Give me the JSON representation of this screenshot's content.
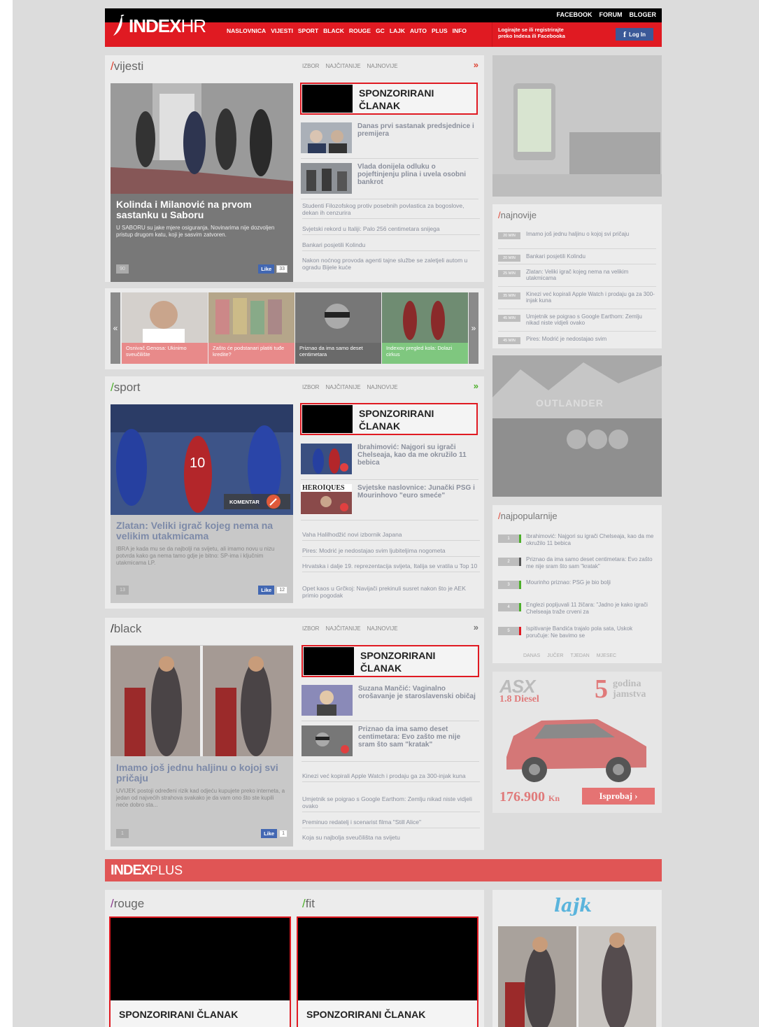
{
  "header": {
    "logo_text": "INDEX",
    "logo_suffix": "HR",
    "top_links": [
      "FACEBOOK",
      "FORUM",
      "BLOGER"
    ],
    "nav": [
      "NASLOVNICA",
      "VIJESTI",
      "SPORT",
      "BLACK",
      "ROUGE",
      "GC",
      "LAJK",
      "AUTO",
      "PLUS",
      "INFO"
    ],
    "login_text_1": "Logirajte se ili registrirajte",
    "login_text_2": "preko Indexa ili Facebooka",
    "login_button": "Log In",
    "fb_glyph": "f"
  },
  "tabs": [
    "IZBOR",
    "NAJČITANIJE",
    "NAJNOVIJE"
  ],
  "sponsored_label_1": "SPONZORIRANI",
  "sponsored_label_2": "ČLANAK",
  "sponsored_full": "SPONZORIRANI ČLANAK",
  "more_glyph": "»",
  "vijesti": {
    "slash": "/",
    "name": "vijesti",
    "main_title": "Kolinda i Milanović na prvom sastanku u Saboru",
    "main_desc": "U SABORU su jake mjere osiguranja. Novinarima nije dozvoljen pristup drugom katu, koji je sasvim zatvoren.",
    "comments": "90",
    "like_label": "Like",
    "likes": "33",
    "articles": [
      "Danas prvi sastanak predsjednice i premijera",
      "Vlada donijela odluku o pojeftinjenju plina i uvela osobni bankrot"
    ],
    "links": [
      "Studenti Filozofskog protiv posebnih povlastica za bogoslove, dekan ih cenzurira",
      "Svjetski rekord u Italiji: Palo 256 centimetara snijega",
      "Bankari posjetili Kolindu",
      "Nakon noćnog provoda agenti tajne službe se zaletjeli autom u ogradu Bijele kuće"
    ]
  },
  "carousel": {
    "prev": "«",
    "next": "»",
    "items": [
      "Osnivač Genosa: Ukinimo sveučilište",
      "Zašto će podstanari platiti tuđe kredite?",
      "Priznao da ima samo deset centimetara",
      "Indexov pregled kola: Dolazi cirkus"
    ]
  },
  "sport": {
    "slash": "/",
    "name": "sport",
    "comment_badge": "KOMENTAR",
    "main_title": "Zlatan: Veliki igrač kojeg nema na velikim utakmicama",
    "main_desc": "IBRA je kada mu se da najbolji na svijetu, ali imamo novu u nizu potvrda kako ga nema tamo gdje je bitno: SP-ima i ključnim utakmicama LP.",
    "comments": "13",
    "like_label": "Like",
    "likes": "12",
    "thumb_label": "HÉROÏQUES",
    "articles": [
      "Ibrahimović: Najgori su igrači Chelseaja, kao da me okružilo 11 bebica",
      "Svjetske naslovnice: Junački PSG i Mourinhovo \"euro smeće\""
    ],
    "links": [
      "Vaha Halilhodžić novi izbornik Japana",
      "Pires: Modrić je nedostajao svim ljubiteljima nogometa",
      "Hrvatska i dalje 19. reprezentacija svijeta, Italija se vratila u Top 10",
      "Opet kaos u Grčkoj: Navijači prekinuli susret nakon što je AEK primio pogodak"
    ]
  },
  "black": {
    "slash": "/",
    "name": "black",
    "main_title": "Imamo još jednu haljinu o kojoj svi pričaju",
    "main_desc": "UVIJEK postoji određeni rizik kad odjeću kupujete preko interneta, a jedan od najvećih strahova svakako je da vam ono što ste kupili neće dobro sta...",
    "comments": "1",
    "like_label": "Like",
    "likes": "1",
    "articles": [
      "Suzana Mančić: Vaginalno orošavanje je staroslavenski običaj",
      "Priznao da ima samo deset centimetara: Evo zašto me nije sram što sam \"kratak\""
    ],
    "links": [
      "Kinezi već kopirali Apple Watch i prodaju ga za 300-injak kuna",
      "Umjetnik se poigrao s Google Earthom: Zemlju nikad niste vidjeli ovako",
      "Preminuo redatelj i scenarist filma \"Still Alice\"",
      "Koja su najbolja sveučilišta na svijetu"
    ]
  },
  "najnovije": {
    "slash": "/",
    "name": "najnovije",
    "items": [
      {
        "time": "20 MIN",
        "text": "Imamo još jednu haljinu o kojoj svi pričaju"
      },
      {
        "time": "20 MIN",
        "text": "Bankari posjetili Kolindu"
      },
      {
        "time": "25 MIN",
        "text": "Zlatan: Veliki igrač kojeg nema na velikim utakmicama"
      },
      {
        "time": "35 MIN",
        "text": "Kinezi već kopirali Apple Watch i prodaju ga za 300-injak kuna"
      },
      {
        "time": "45 MIN",
        "text": "Umjetnik se poigrao s Google Earthom: Zemlju nikad niste vidjeli ovako"
      },
      {
        "time": "45 MIN",
        "text": "Pires: Modrić je nedostajao svim"
      }
    ]
  },
  "najpopularnije": {
    "slash": "/",
    "name": "najpopularnije",
    "items": [
      {
        "num": "1",
        "color": "#4caf2a",
        "text": "Ibrahimović: Najgori su igrači Chelseaja, kao da me okružilo 11 bebica"
      },
      {
        "num": "2",
        "color": "#555555",
        "text": "Priznao da ima samo deset centimetara: Evo zašto me nije sram što sam \"kratak\""
      },
      {
        "num": "3",
        "color": "#4caf2a",
        "text": "Mourinho priznao: PSG je bio bolji"
      },
      {
        "num": "4",
        "color": "#4caf2a",
        "text": "Englezi popljuvali 11 žičara: \"Jadno je kako igrači Chelseaja traže crveni za"
      },
      {
        "num": "5",
        "color": "#e01a22",
        "text": "Ispitivanje Bandića trajalo pola sata, Uskok poručuje: Ne bavimo se"
      }
    ],
    "tabs": [
      "DANAS",
      "JUČER",
      "TJEDAN",
      "MJESEC"
    ]
  },
  "car_ad": {
    "model": "ASX",
    "engine": "1.8 Diesel",
    "warranty_num": "5",
    "warranty_text_1": "godina",
    "warranty_text_2": "jamstva",
    "price": "176.900",
    "currency": "Kn",
    "cta": "Isprobaj ›"
  },
  "outlander_ad": {
    "text": "OUTLANDER"
  },
  "plus": {
    "logo": "INDEX",
    "suffix": "PLUS"
  },
  "rouge": {
    "slash": "/",
    "name": "rouge"
  },
  "fit": {
    "slash": "/",
    "name": "fit"
  },
  "lajk": {
    "logo": "lajk"
  }
}
